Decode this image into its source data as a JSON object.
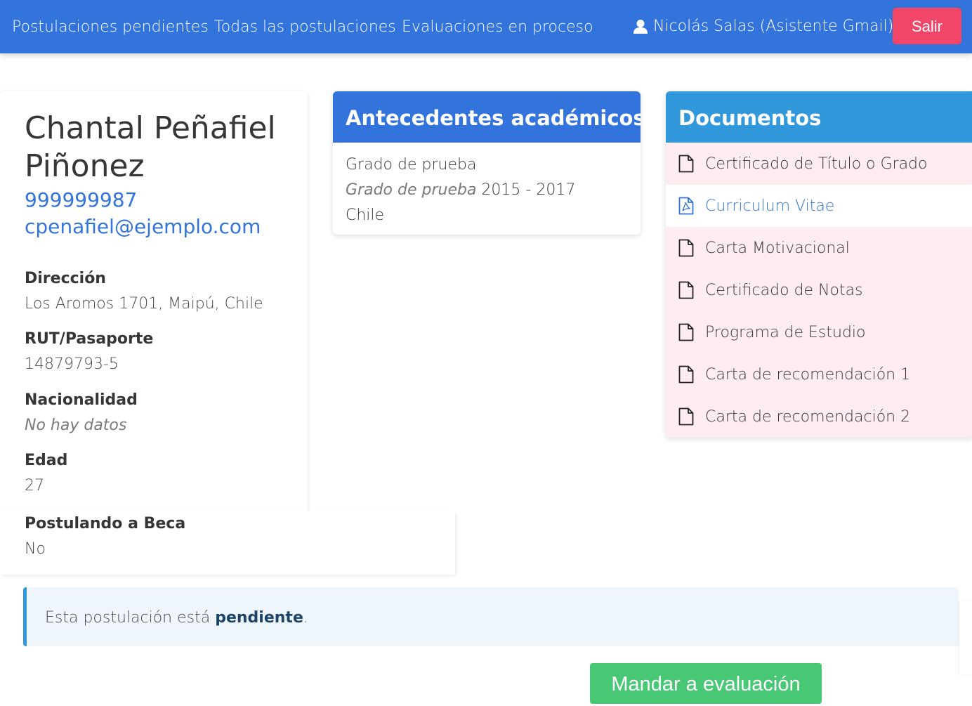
{
  "nav": {
    "links": [
      "Postulaciones pendientes",
      "Todas las postulaciones",
      "Evaluaciones en proceso"
    ],
    "user": "Nicolás Salas (Asistente Gmail)",
    "user_icon": "user-icon",
    "logout_label": "Salir"
  },
  "profile": {
    "name": "Chantal Peñafiel Piñonez",
    "phone": "999999987",
    "email": "cpenafiel@ejemplo.com",
    "fields": [
      {
        "label": "Dirección",
        "value": "Los Aromos 1701, Maipú, Chile"
      },
      {
        "label": "RUT/Pasaporte",
        "value": "14879793-5"
      },
      {
        "label": "Nacionalidad",
        "value": "No hay datos"
      },
      {
        "label": "Edad",
        "value": "27"
      },
      {
        "label": "Postulando a Beca",
        "value": "No"
      }
    ]
  },
  "academic": {
    "title": "Antecedentes académicos",
    "degree": "Grado de prueba",
    "degree_italic": "Grado de prueba",
    "years": "2015 - 2017",
    "country": "Chile"
  },
  "documents": {
    "title": "Documentos",
    "items": [
      {
        "label": "Certificado de Título o Grado",
        "status": "missing",
        "icon": "file-icon"
      },
      {
        "label": "Curriculum Vitae",
        "status": "available",
        "icon": "pdf-file-icon"
      },
      {
        "label": "Carta Motivacional",
        "status": "missing",
        "icon": "file-icon"
      },
      {
        "label": "Certificado de Notas",
        "status": "missing",
        "icon": "file-icon"
      },
      {
        "label": "Programa de Estudio",
        "status": "missing",
        "icon": "file-icon"
      },
      {
        "label": "Carta de recomendación 1",
        "status": "missing",
        "icon": "file-icon"
      },
      {
        "label": "Carta de recomendación 2",
        "status": "missing",
        "icon": "file-icon"
      }
    ]
  },
  "status": {
    "prefix": "Esta postulación está ",
    "state": "pendiente",
    "suffix": "."
  },
  "actions": {
    "evaluate_label": "Mandar a evaluación"
  },
  "colors": {
    "primary": "#3273dc",
    "info": "#3298dc",
    "danger": "#f14668",
    "success": "#48c774",
    "missing_bg": "#feecf0",
    "notice_bg": "#eef6fc"
  }
}
